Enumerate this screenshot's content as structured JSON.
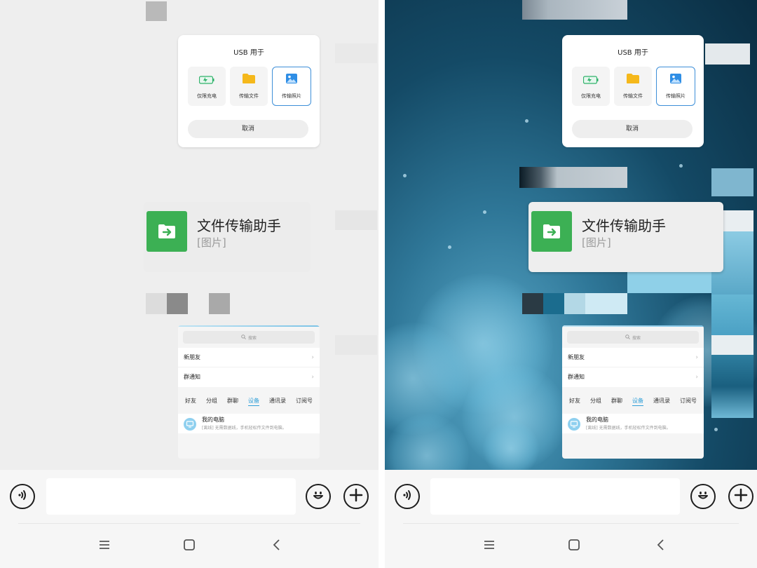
{
  "usb_dialog": {
    "title": "USB 用于",
    "options": [
      {
        "label": "仅限充电",
        "icon": "battery-charging-icon"
      },
      {
        "label": "传输文件",
        "icon": "folder-icon"
      },
      {
        "label": "传输照片",
        "icon": "photo-icon",
        "selected": true
      }
    ],
    "cancel_label": "取消"
  },
  "chat_card": {
    "title": "文件传输助手",
    "subtitle": "[图片]"
  },
  "contacts": {
    "search_placeholder": "搜索",
    "rows": [
      "新朋友",
      "群通知"
    ],
    "tabs": [
      "好友",
      "分组",
      "群聊",
      "设备",
      "通讯录",
      "订阅号"
    ],
    "active_tab": "设备",
    "device": {
      "name": "我的电脑",
      "description": "[离线] 无需数据线，手机轻松传文件到电脑。"
    }
  },
  "colors": {
    "accent_blue": "#3d8fd8",
    "file_transfer_green": "#3cb054",
    "active_tab": "#2f9fd8"
  }
}
